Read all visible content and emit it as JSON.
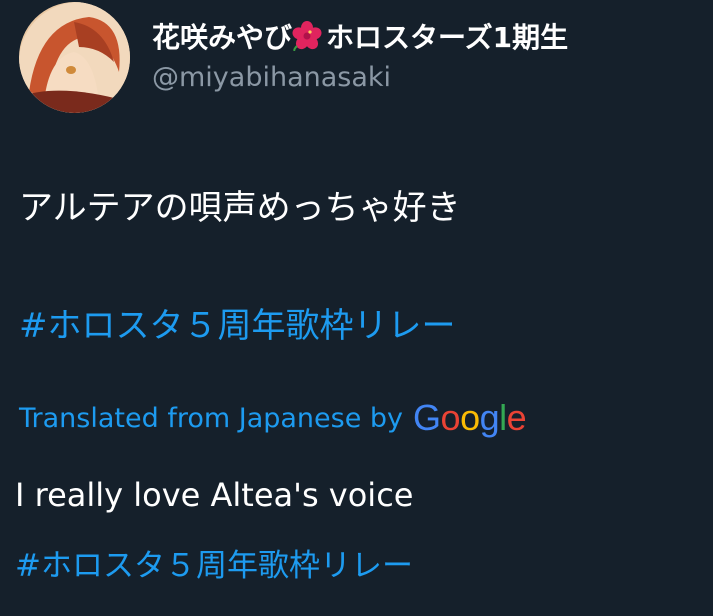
{
  "author": {
    "display_name_prefix": "花咲みやび",
    "display_name_suffix": "ホロスターズ1期生",
    "handle": "@miyabihanasaki",
    "emoji_icon": "hibiscus-icon"
  },
  "tweet": {
    "text": "アルテアの唄声めっちゃ好き",
    "hashtag": "#ホロスタ５周年歌枠リレー"
  },
  "translation": {
    "label": "Translated from Japanese by",
    "logo_letters": [
      "G",
      "o",
      "o",
      "g",
      "l",
      "e"
    ],
    "text": "I really love Altea's voice",
    "hashtag": "#ホロスタ５周年歌枠リレー"
  },
  "colors": {
    "background": "#15202b",
    "link": "#1d9bf0",
    "secondary_text": "#8b98a5",
    "primary_text": "#ffffff"
  }
}
